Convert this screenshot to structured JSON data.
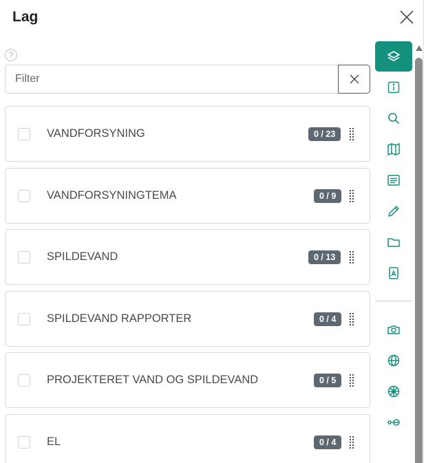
{
  "panel": {
    "title": "Lag"
  },
  "help": {
    "glyph": "?"
  },
  "filter": {
    "placeholder": "Filter",
    "value": ""
  },
  "layers": [
    {
      "name": "VANDFORSYNING",
      "badge": "0 / 23"
    },
    {
      "name": "VANDFORSYNINGTEMA",
      "badge": "0 / 9"
    },
    {
      "name": "SPILDEVAND",
      "badge": "0 / 13"
    },
    {
      "name": "SPILDEVAND RAPPORTER",
      "badge": "0 / 4"
    },
    {
      "name": "PROJEKTERET VAND OG SPILDEVAND",
      "badge": "0 / 5"
    },
    {
      "name": "EL",
      "badge": "0 / 4"
    }
  ],
  "toolbar": {
    "items": [
      {
        "icon": "layers-icon",
        "active": true
      },
      {
        "icon": "info-icon",
        "active": false
      },
      {
        "icon": "search-icon",
        "active": false
      },
      {
        "icon": "map-icon",
        "active": false
      },
      {
        "icon": "text-lines-icon",
        "active": false
      },
      {
        "icon": "pencil-icon",
        "active": false
      },
      {
        "icon": "folder-icon",
        "active": false
      },
      {
        "icon": "pdf-icon",
        "active": false
      },
      {
        "icon": "camera-icon",
        "active": false
      },
      {
        "icon": "globe-icon",
        "active": false
      },
      {
        "icon": "wheel-icon",
        "active": false
      },
      {
        "icon": "measure-icon",
        "active": false
      }
    ]
  },
  "colors": {
    "accent": "#13907e",
    "icon": "#13907e",
    "badge": "#5e6870"
  }
}
